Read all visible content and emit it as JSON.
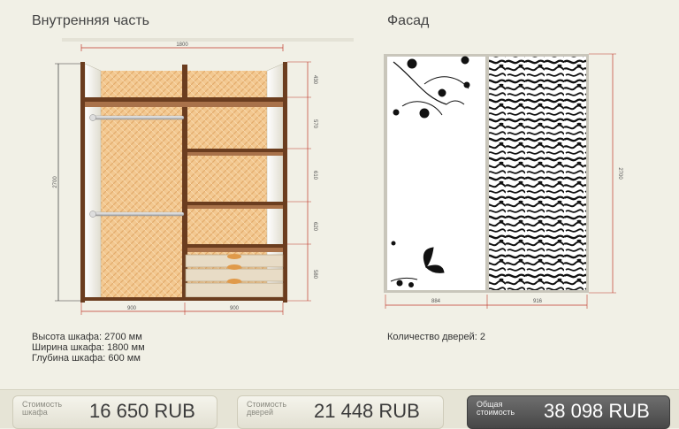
{
  "interior": {
    "title": "Внутренняя часть",
    "dims": {
      "width_total": "1800",
      "height_total": "2700",
      "bottom_left": "900",
      "bottom_right": "900",
      "shelves": [
        "430",
        "570",
        "610",
        "620",
        "580"
      ]
    },
    "info": {
      "height": "Высота шкафа: 2700 мм",
      "width": "Ширина шкафа: 1800 мм",
      "depth": "Глубина шкафа: 600 мм"
    }
  },
  "facade": {
    "title": "Фасад",
    "dims": {
      "height": "2700",
      "left_width": "884",
      "right_width": "916"
    },
    "door_count": "Количество дверей: 2"
  },
  "footer": {
    "wardrobe_cost": {
      "label": "Стоимость шкафа",
      "value": "16 650  RUB"
    },
    "doors_cost": {
      "label": "Стоимость дверей",
      "value": "21 448  RUB"
    },
    "total_cost": {
      "label": "Общая стоимость",
      "value": "38 098  RUB"
    }
  },
  "colors": {
    "background": "#f1f0e6",
    "wood_dark": "#6b3d1f",
    "panel_back": "#f0c58e",
    "dim_red": "#c0392b",
    "total_button": "#555555"
  }
}
